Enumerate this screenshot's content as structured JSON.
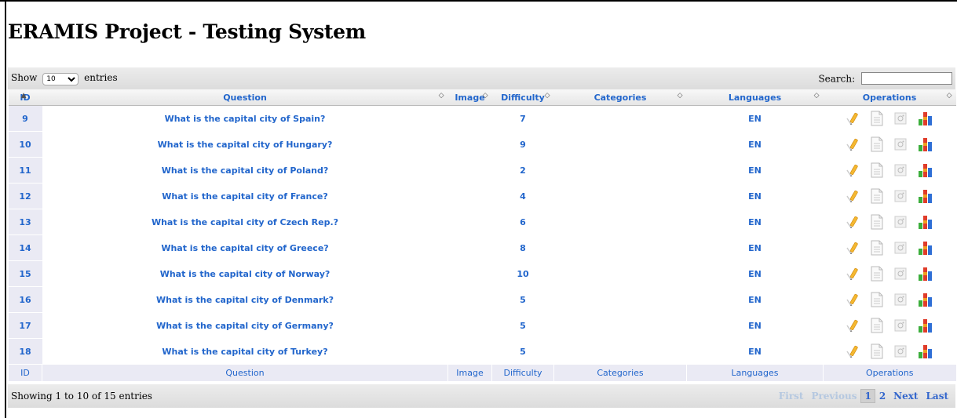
{
  "page": {
    "title": "ERAMIS Project - Testing System"
  },
  "toolbar": {
    "show_label": "Show",
    "page_size": "10",
    "entries_label": "entries",
    "search_label": "Search:",
    "search_value": ""
  },
  "table": {
    "headers": [
      "ID",
      "Question",
      "Image",
      "Difficulty",
      "Categories",
      "Languages",
      "Operations"
    ],
    "footers": [
      "ID",
      "Question",
      "Image",
      "Difficulty",
      "Categories",
      "Languages",
      "Operations"
    ],
    "rows": [
      {
        "id": "9",
        "question": "What is the capital city of Spain?",
        "image": "",
        "difficulty": "7",
        "categories": "",
        "languages": "EN"
      },
      {
        "id": "10",
        "question": "What is the capital city of Hungary?",
        "image": "",
        "difficulty": "9",
        "categories": "",
        "languages": "EN"
      },
      {
        "id": "11",
        "question": "What is the capital city of Poland?",
        "image": "",
        "difficulty": "2",
        "categories": "",
        "languages": "EN"
      },
      {
        "id": "12",
        "question": "What is the capital city of France?",
        "image": "",
        "difficulty": "4",
        "categories": "",
        "languages": "EN"
      },
      {
        "id": "13",
        "question": "What is the capital city of Czech Rep.?",
        "image": "",
        "difficulty": "6",
        "categories": "",
        "languages": "EN"
      },
      {
        "id": "14",
        "question": "What is the capital city of Greece?",
        "image": "",
        "difficulty": "8",
        "categories": "",
        "languages": "EN"
      },
      {
        "id": "15",
        "question": "What is the capital city of Norway?",
        "image": "",
        "difficulty": "10",
        "categories": "",
        "languages": "EN"
      },
      {
        "id": "16",
        "question": "What is the capital city of Denmark?",
        "image": "",
        "difficulty": "5",
        "categories": "",
        "languages": "EN"
      },
      {
        "id": "17",
        "question": "What is the capital city of Germany?",
        "image": "",
        "difficulty": "5",
        "categories": "",
        "languages": "EN"
      },
      {
        "id": "18",
        "question": "What is the capital city of Turkey?",
        "image": "",
        "difficulty": "5",
        "categories": "",
        "languages": "EN"
      }
    ],
    "operations_icons": [
      "edit-icon",
      "document-icon",
      "image-icon",
      "stats-icon"
    ]
  },
  "footer": {
    "info": "Showing 1 to 10 of 15 entries",
    "pager": {
      "first": "First",
      "previous": "Previous",
      "page1": "1",
      "page2": "2",
      "next": "Next",
      "last": "Last"
    }
  },
  "colors": {
    "link": "#2266cc",
    "header_bg": "#e6e6e6",
    "id_bg": "#eaeaf4"
  }
}
